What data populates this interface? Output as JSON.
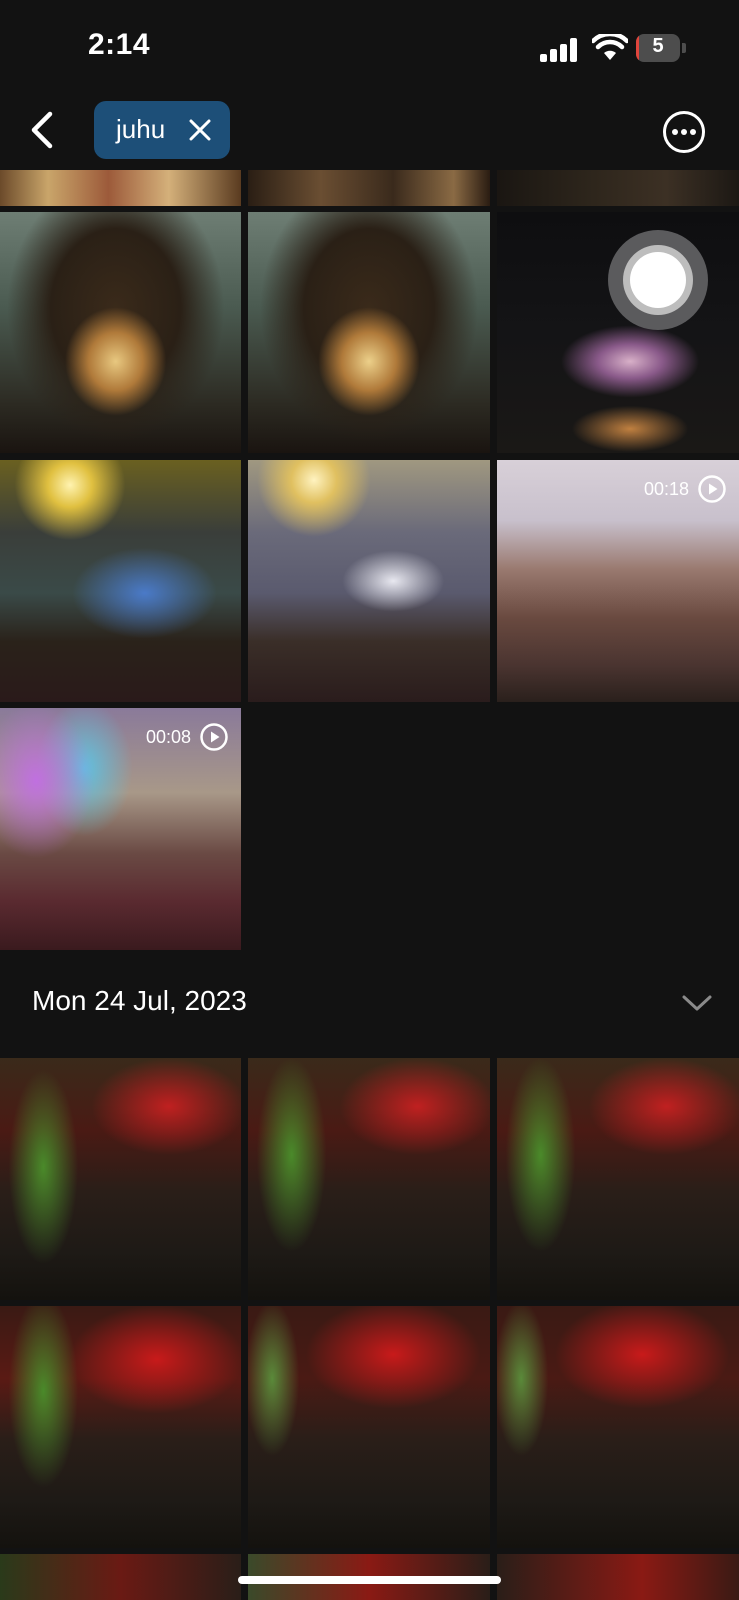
{
  "status_bar": {
    "time": "2:14",
    "battery_level": "5",
    "battery_fraction": 0.05
  },
  "top_bar": {
    "search_chip_label": "juhu"
  },
  "sections": [
    {
      "videos": [
        {
          "duration": "00:18"
        },
        {
          "duration": "00:08"
        }
      ]
    },
    {
      "date_label": "Mon 24 Jul, 2023"
    }
  ],
  "icons": {
    "back": "chevron-left-icon",
    "chip_close": "close-icon",
    "more": "more-horizontal-icon",
    "play": "play-icon",
    "collapse": "chevron-down-icon",
    "assistive_touch": "assistive-touch-icon"
  },
  "colors": {
    "background": "#121212",
    "chip": "#1d4f78",
    "battery_low": "#e0453c"
  }
}
